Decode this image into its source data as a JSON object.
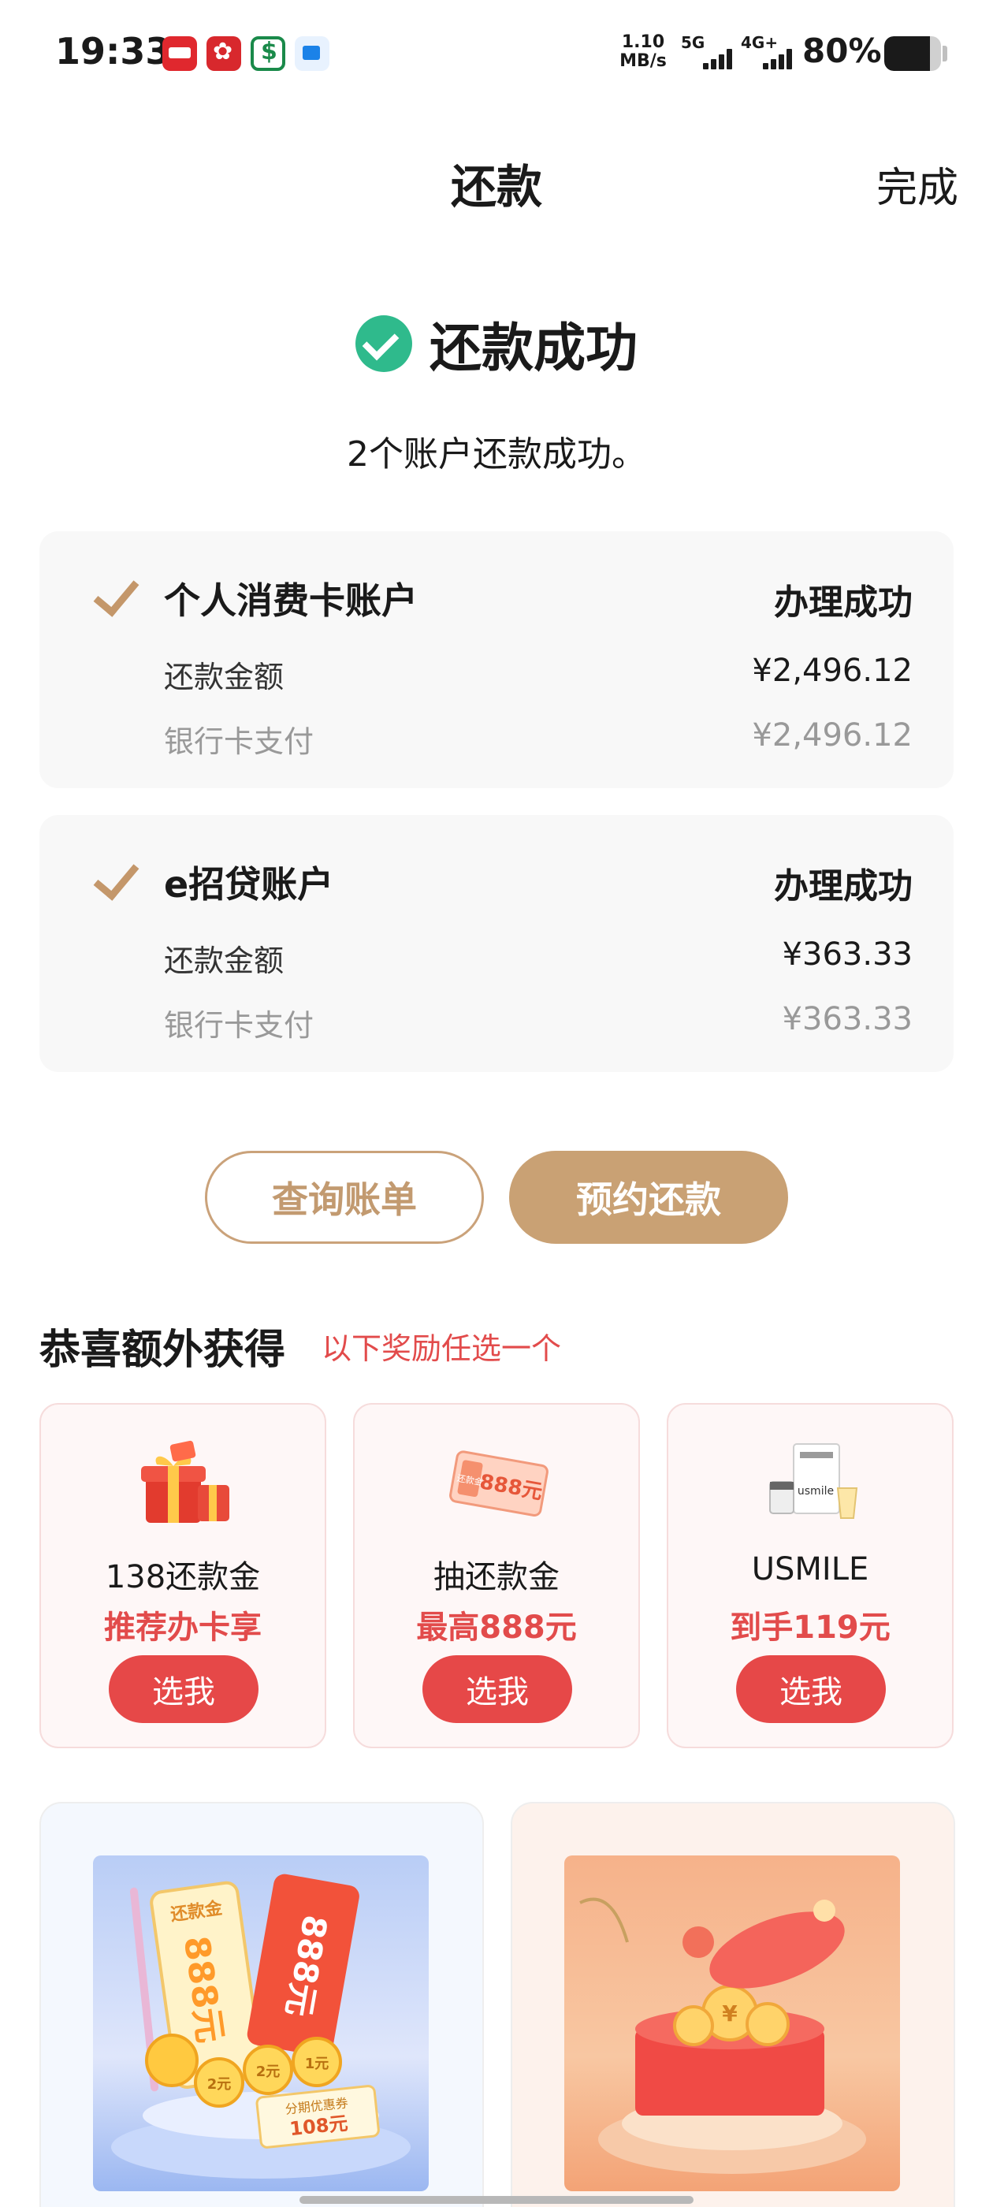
{
  "status_bar": {
    "time": "19:33",
    "speed_value": "1.10",
    "speed_unit": "MB/s",
    "network_1": "5G",
    "network_2": "4G+",
    "battery_percent_text": "80%",
    "battery_level": 0.8,
    "app_icons": [
      "yunshanfu-icon",
      "flower-app-icon",
      "postal-bank-icon",
      "message-app-icon"
    ]
  },
  "header": {
    "title": "还款",
    "done_label": "完成"
  },
  "result": {
    "title": "还款成功",
    "subtitle": "2个账户还款成功。"
  },
  "accounts": [
    {
      "name": "个人消费卡账户",
      "status": "办理成功",
      "amount_label": "还款金额",
      "amount": "¥2,496.12",
      "payment_label": "银行卡支付",
      "payment_amount": "¥2,496.12"
    },
    {
      "name": "e招贷账户",
      "status": "办理成功",
      "amount_label": "还款金额",
      "amount": "¥363.33",
      "payment_label": "银行卡支付",
      "payment_amount": "¥363.33"
    }
  ],
  "actions": {
    "query_label": "查询账单",
    "book_label": "预约还款"
  },
  "rewards": {
    "title": "恭喜额外获得",
    "subtitle": "以下奖励任选一个",
    "items": [
      {
        "name": "138还款金",
        "desc": "推荐办卡享",
        "button": "选我"
      },
      {
        "name": "抽还款金",
        "desc": "最高888元",
        "button": "选我",
        "ticket_text": "888元",
        "ticket_label": "还款金"
      },
      {
        "name": "USMILE",
        "desc": "到手119元",
        "button": "选我",
        "brand_text": "usmile"
      }
    ]
  },
  "promos": {
    "p1": {
      "ticket_label": "还款金",
      "ticket_value": "888元",
      "card_value": "888元",
      "coins": [
        "2元",
        "2元",
        "1元"
      ],
      "coupon_label": "分期优惠券",
      "coupon_value": "108元"
    }
  },
  "colors": {
    "success_green": "#2fba8c",
    "gold_accent": "#c9a174",
    "reward_red": "#e64848"
  }
}
